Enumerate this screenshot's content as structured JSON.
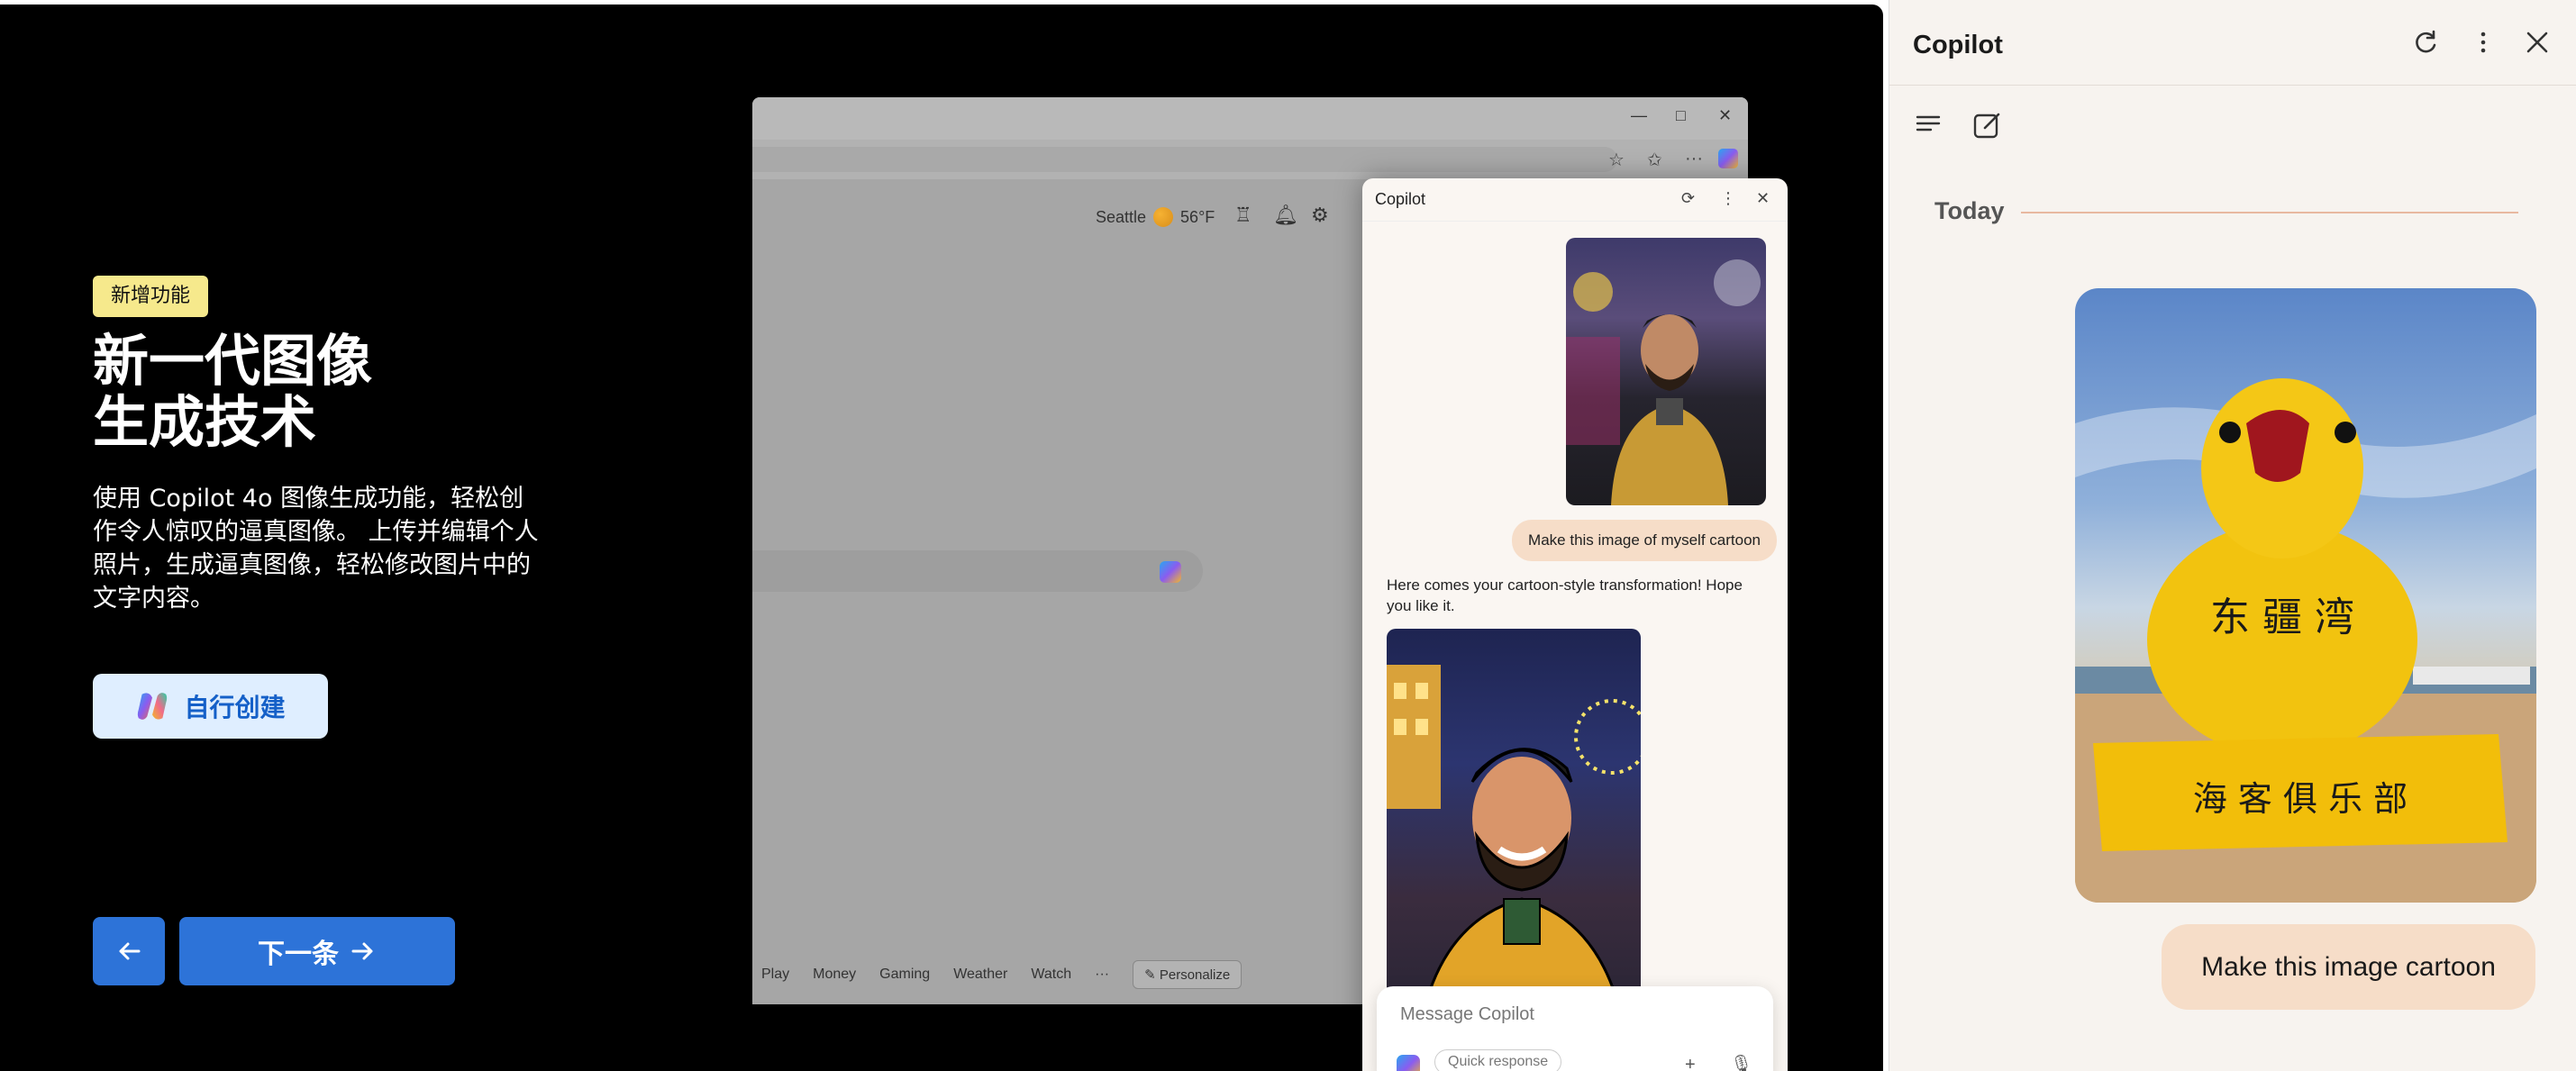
{
  "promo": {
    "badge": "新增功能",
    "headline_line1": "新一代图像",
    "headline_line2": "生成技术",
    "description": "使用 Copilot 4o 图像生成功能，轻松创作令人惊叹的逼真图像。 上传并编辑个人照片，生成逼真图像，轻松修改图片中的文字内容。",
    "create_button": "自行创建",
    "prev_icon": "arrow-left-icon",
    "next_button": "下一条",
    "next_icon": "arrow-right-icon"
  },
  "browser": {
    "weather_city": "Seattle",
    "weather_temp": "56°F",
    "nav_items": [
      "Play",
      "Money",
      "Gaming",
      "Weather",
      "Watch",
      "···"
    ],
    "personalize": "Personalize"
  },
  "popup": {
    "title": "Copilot",
    "user_message": "Make this image of myself cartoon",
    "reply": "Here comes your cartoon-style transformation! Hope you like it.",
    "input_placeholder": "Message Copilot",
    "quick_response": "Quick response"
  },
  "sidepanel": {
    "title": "Copilot",
    "section_label": "Today",
    "user_message": "Make this image cartoon",
    "sign_top": "东 疆 湾",
    "sign_base": "海 客 俱 乐 部"
  },
  "colors": {
    "accent_blue": "#2d73d8",
    "badge_yellow": "#f6e98c",
    "user_bubble": "#f6ddc8"
  }
}
